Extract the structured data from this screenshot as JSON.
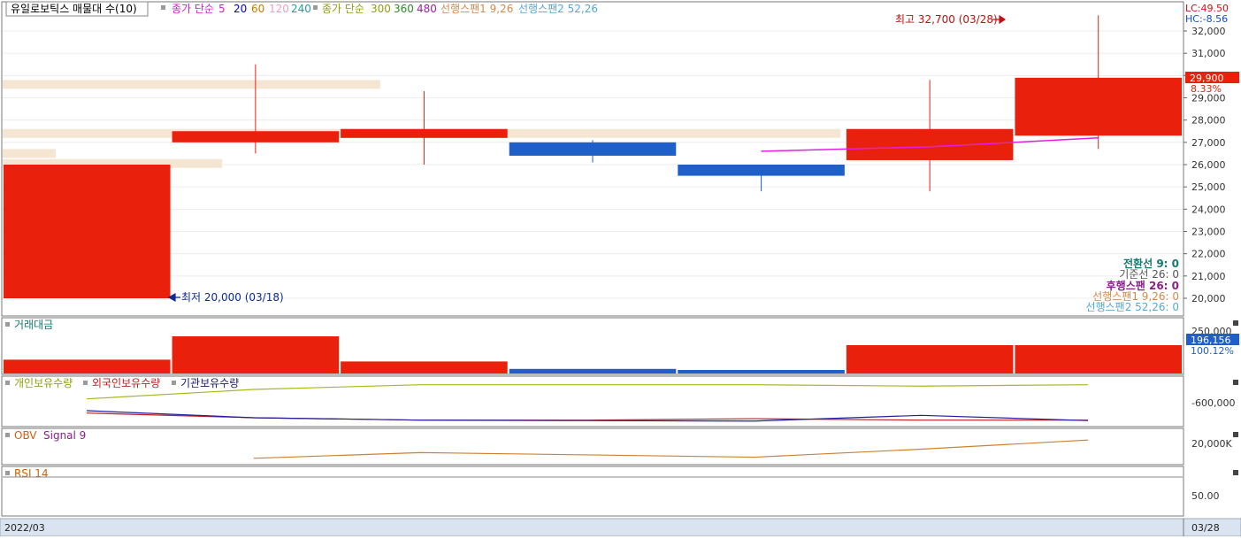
{
  "main_legend": {
    "title": "유일로보틱스 매물대 수(10)",
    "ma1_label": "종가 단순",
    "ma1_periods": [
      "5",
      "20",
      "60",
      "120",
      "240"
    ],
    "ma2_label": "종가 단순",
    "ma2_periods": [
      "300",
      "360",
      "480"
    ],
    "span1": "선행스팬1 9,26",
    "span2": "선행스팬2 52,26"
  },
  "indicator_readout": {
    "lc": "LC:49.50",
    "hc": "HC:-8.56",
    "last_price": "29,900",
    "last_change": "8.33%"
  },
  "annotations": {
    "high": "최고 32,700 (03/28)",
    "low": "최저 20,000 (03/18)"
  },
  "ichimoku_legend": [
    {
      "label": "전환선 9: 0",
      "color": "#127a6e"
    },
    {
      "label": "기준선 26: 0",
      "color": "#555555"
    },
    {
      "label": "후행스팬 26: 0",
      "color": "#8a208a"
    },
    {
      "label": "선행스팬1 9,26: 0",
      "color": "#d48a4f"
    },
    {
      "label": "선행스팬2 52,26: 0",
      "color": "#55a7d8"
    }
  ],
  "volume_panel": {
    "title": "거래대금",
    "last_value": "196,156",
    "last_pct": "100.12%"
  },
  "holdings_panel": {
    "labels": [
      "개인보유수량",
      "외국인보유수량",
      "기관보유수량"
    ],
    "tick": "-600,000"
  },
  "obv_panel": {
    "labels": [
      "OBV",
      "Signal 9"
    ],
    "tick": "20,000K"
  },
  "rsi_panel": {
    "label": "RSI 14",
    "tick": "50.00"
  },
  "time_axis": {
    "left": "2022/03",
    "right": "03/28"
  },
  "colors": {
    "up": "#e8200c",
    "down": "#1f5fc8",
    "profile": "#f5e6d3",
    "ma5": "#e020e0",
    "individual": "#a8b820",
    "foreign": "#c02020",
    "institution": "#2020a0",
    "obv": "#d08030"
  },
  "chart_data": {
    "type": "candlestick",
    "y_axis_ticks": [
      20000,
      21000,
      22000,
      23000,
      24000,
      25000,
      26000,
      27000,
      28000,
      29000,
      30000,
      31000,
      32000
    ],
    "ylim": [
      19500,
      33500
    ],
    "candles": [
      {
        "open": 20000,
        "close": 26000,
        "high": 26000,
        "low": 20000
      },
      {
        "open": 27000,
        "close": 27500,
        "high": 30500,
        "low": 26500
      },
      {
        "open": 27200,
        "close": 27600,
        "high": 29300,
        "low": 26000
      },
      {
        "open": 27000,
        "close": 26400,
        "high": 27100,
        "low": 26100
      },
      {
        "open": 26000,
        "close": 25500,
        "high": 26000,
        "low": 24800
      },
      {
        "open": 26200,
        "close": 27600,
        "high": 29800,
        "low": 24800
      },
      {
        "open": 27300,
        "close": 29900,
        "high": 32700,
        "low": 26700
      }
    ],
    "ma5": [
      null,
      null,
      null,
      null,
      26600,
      26800,
      27200
    ],
    "volume_profile": [
      {
        "price": 29600,
        "length": 0.32
      },
      {
        "price": 27400,
        "length": 0.71
      },
      {
        "price": 26500,
        "length": 0.045
      },
      {
        "price": 26050,
        "length": 0.186
      }
    ],
    "trading_value": {
      "ylim": [
        0,
        250000
      ],
      "values": [
        78000,
        210000,
        68000,
        26000,
        20000,
        160000,
        160000
      ]
    },
    "holdings": {
      "individual": [
        -600000,
        -400000,
        -300000,
        -300000,
        -300000,
        -330000,
        -300000
      ],
      "foreign": [
        -900000,
        -1000000,
        -1050000,
        -1050000,
        -1020000,
        -1050000,
        -1050000
      ],
      "institution": [
        -850000,
        -1000000,
        -1050000,
        -1060000,
        -1070000,
        -950000,
        -1060000
      ]
    },
    "obv": [
      null,
      20000,
      22500,
      21500,
      20500,
      24000,
      28000
    ]
  }
}
